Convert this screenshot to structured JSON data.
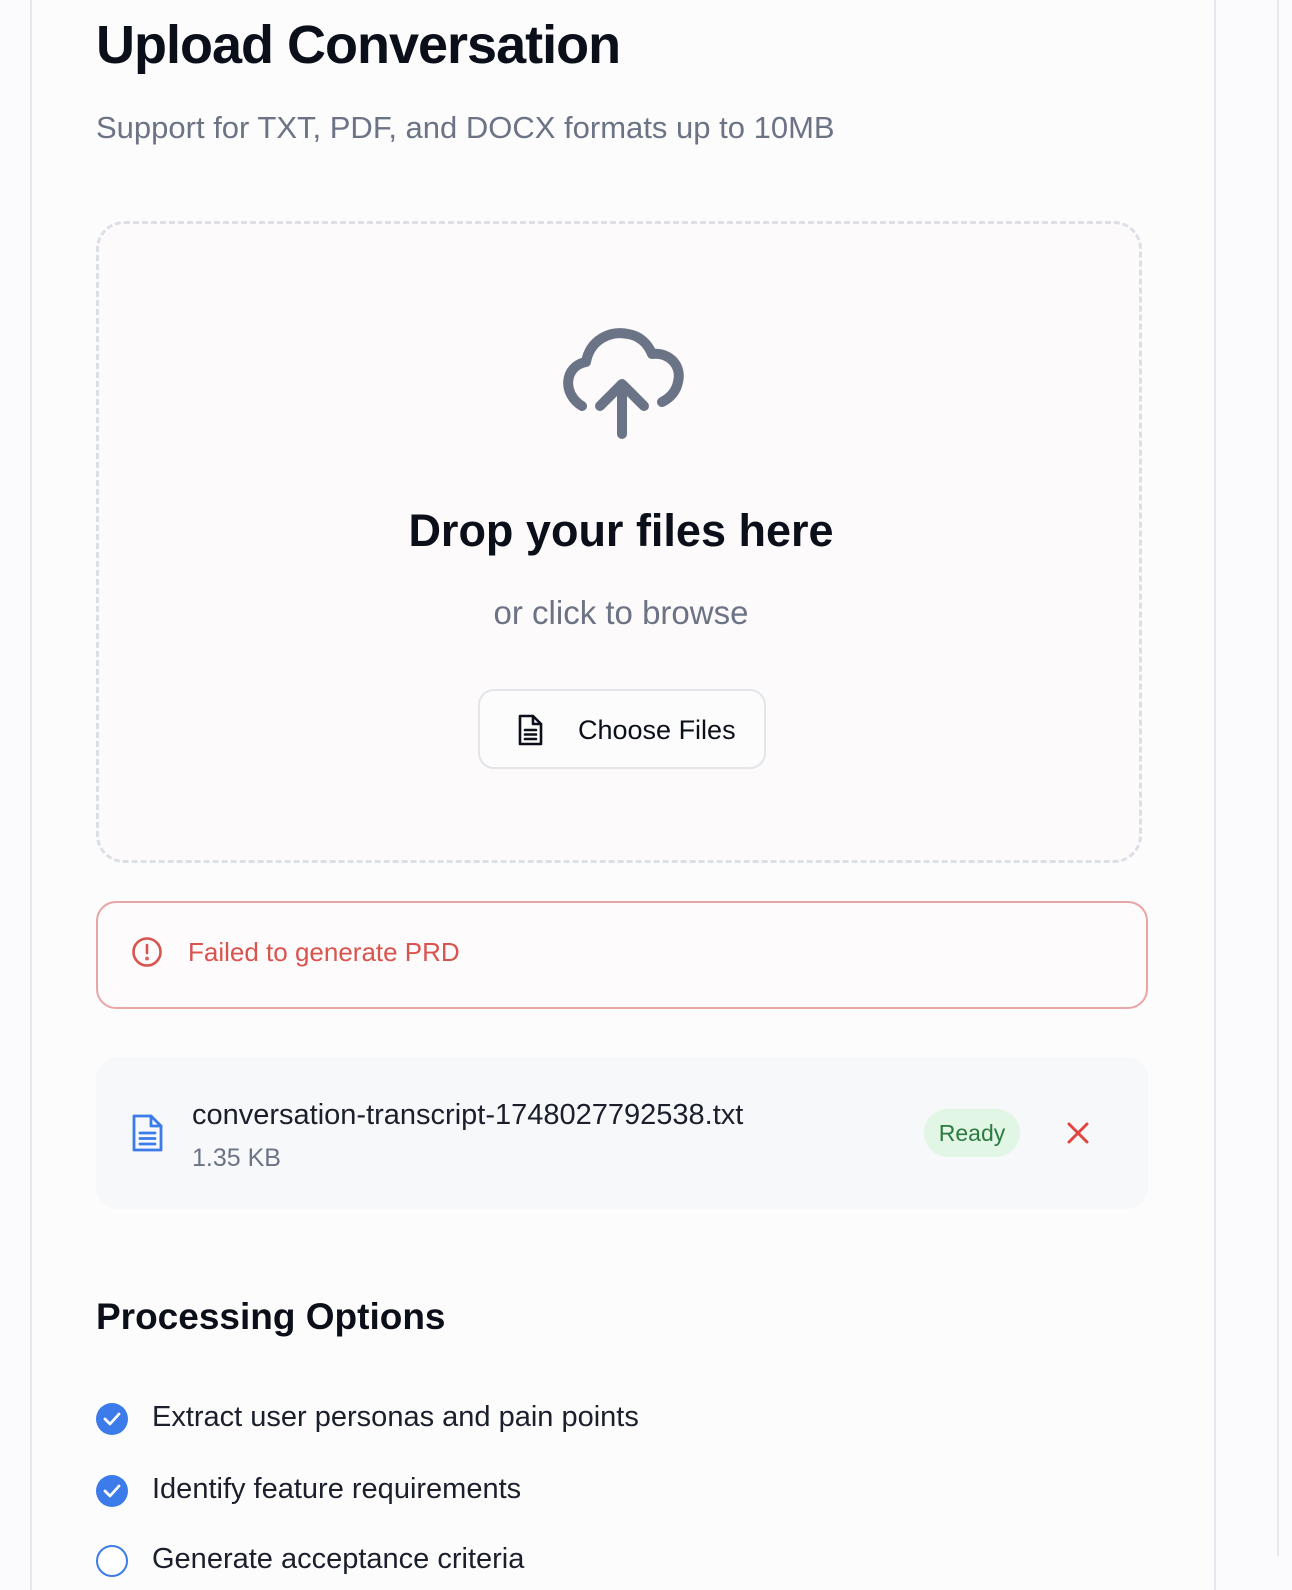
{
  "page": {
    "title": "Upload Conversation",
    "subtitle": "Support for TXT, PDF, and DOCX formats up to 10MB"
  },
  "dropzone": {
    "icon": "cloud-upload-icon",
    "title": "Drop your files here",
    "subtitle": "or click to browse",
    "button_icon": "file-text-icon",
    "button_label": "Choose Files"
  },
  "error": {
    "icon": "alert-circle-icon",
    "message": "Failed to generate PRD",
    "color": "#d9544f"
  },
  "file": {
    "icon": "file-text-icon",
    "name": "conversation-transcript-1748027792538.txt",
    "size": "1.35 KB",
    "status": "Ready",
    "remove_icon": "close-icon"
  },
  "processing": {
    "title": "Processing Options",
    "options": [
      {
        "label": "Extract user personas and pain points",
        "checked": true
      },
      {
        "label": "Identify feature requirements",
        "checked": true
      },
      {
        "label": "Generate acceptance criteria",
        "checked": false
      }
    ]
  },
  "colors": {
    "accent": "#3b7bea",
    "success_bg": "#e2f6e6",
    "success_text": "#2c7a40"
  }
}
